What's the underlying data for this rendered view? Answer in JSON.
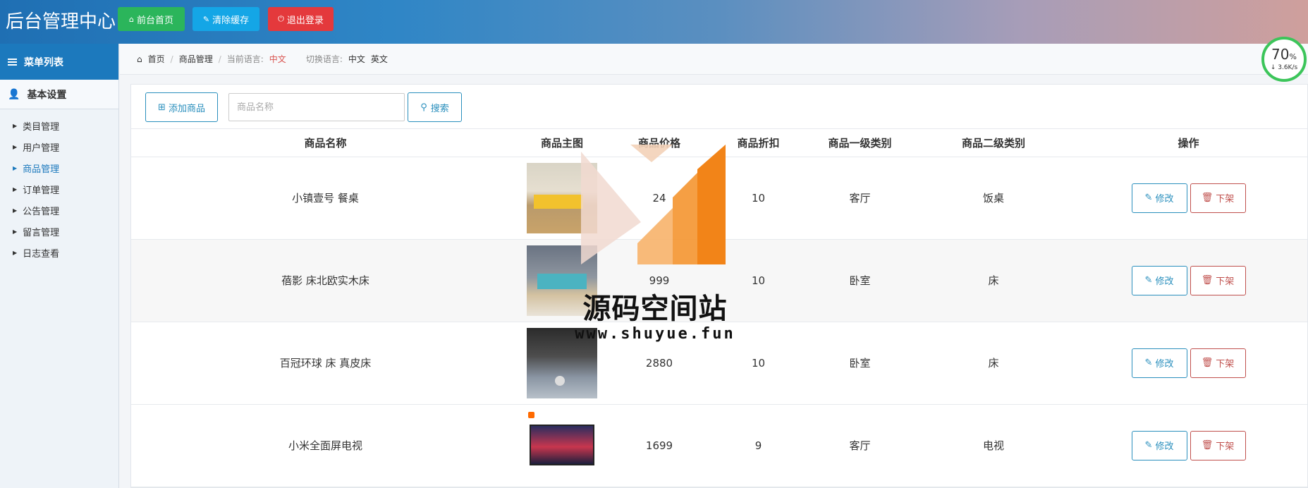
{
  "header": {
    "title": "后台管理中心",
    "buttons": {
      "home": "前台首页",
      "clear_cache": "清除缓存",
      "logout": "退出登录"
    },
    "colors": {
      "home": "#2bb55b",
      "clear_cache": "#14a6e6",
      "logout": "#e4393c"
    }
  },
  "sidebar": {
    "menu_title": "菜单列表",
    "group_title": "基本设置",
    "items": [
      {
        "label": "类目管理",
        "active": false
      },
      {
        "label": "用户管理",
        "active": false
      },
      {
        "label": "商品管理",
        "active": true
      },
      {
        "label": "订单管理",
        "active": false
      },
      {
        "label": "公告管理",
        "active": false
      },
      {
        "label": "留言管理",
        "active": false
      },
      {
        "label": "日志查看",
        "active": false
      }
    ]
  },
  "breadcrumb": {
    "home": "首页",
    "current": "商品管理",
    "lang_label": "当前语言:",
    "lang_value": "中文",
    "switch_label": "切换语言:",
    "switch_zh": "中文",
    "switch_en": "英文"
  },
  "speed_widget": {
    "percent": "70",
    "unit": "%",
    "rate": "3.6K/s"
  },
  "toolbar": {
    "add_label": "添加商品",
    "search_placeholder": "商品名称",
    "search_value": "",
    "search_label": "搜索"
  },
  "table": {
    "columns": [
      "商品名称",
      "商品主图",
      "商品价格",
      "商品折扣",
      "商品一级类别",
      "商品二级类别",
      "操作"
    ],
    "rows": [
      {
        "name": "小镇壹号 餐桌",
        "image": "dining-table-photo",
        "price": "24",
        "discount": "10",
        "cat1": "客厅",
        "cat2": "饭桌"
      },
      {
        "name": "蓓影 床北欧实木床",
        "image": "wooden-bed-photo",
        "price": "999",
        "discount": "10",
        "cat1": "卧室",
        "cat2": "床"
      },
      {
        "name": "百冠环球 床 真皮床",
        "image": "leather-bed-photo",
        "price": "2880",
        "discount": "10",
        "cat1": "卧室",
        "cat2": "床"
      },
      {
        "name": "小米全面屏电视",
        "image": "tv-photo",
        "price": "1699",
        "discount": "9",
        "cat1": "客厅",
        "cat2": "电视"
      }
    ],
    "edit_label": "修改",
    "off_label": "下架"
  },
  "watermark": {
    "title": "源码空间站",
    "url": "www.shuyue.fun"
  }
}
